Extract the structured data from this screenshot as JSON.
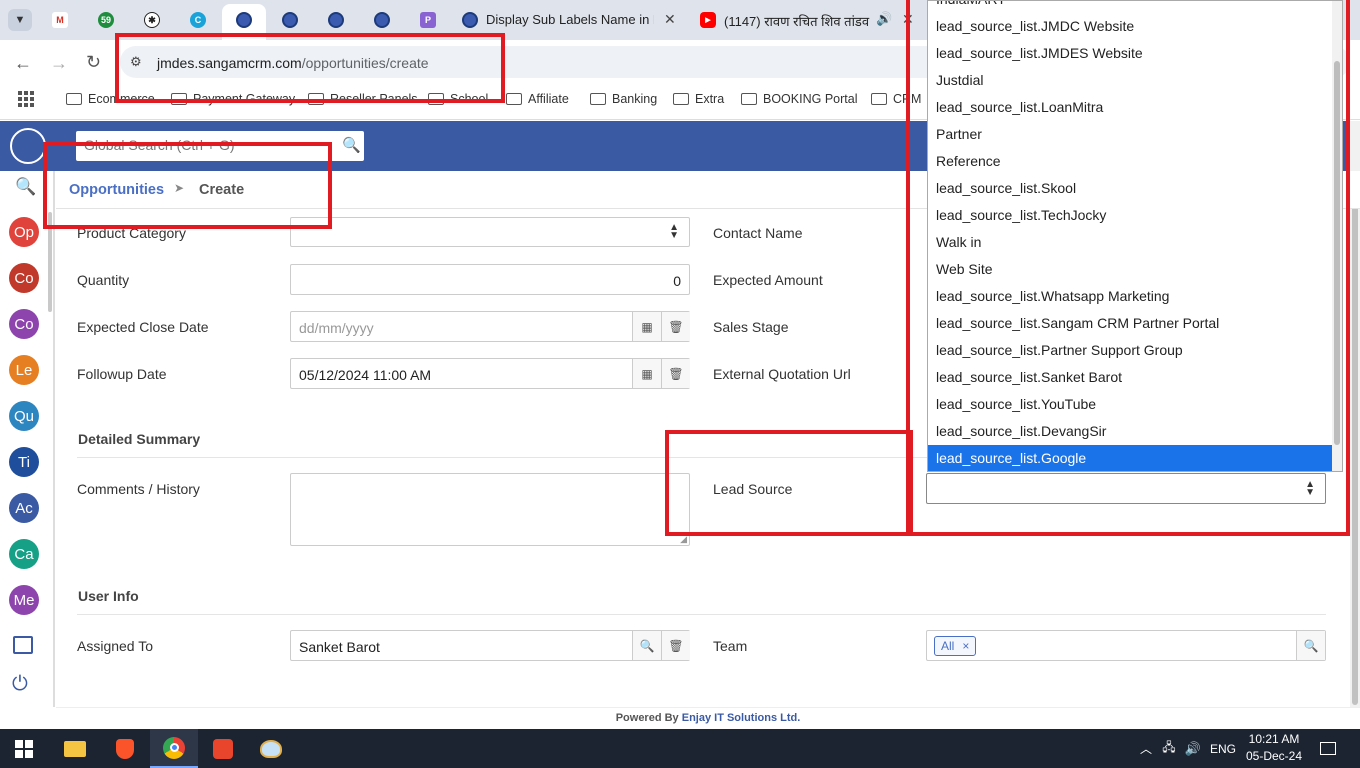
{
  "browser": {
    "tabs": [
      {
        "title": "Display Sub Labels Name in Dro"
      },
      {
        "title": "(1147) रावण रचित शिव तांडव"
      }
    ],
    "gmail_badge": "59",
    "url_host": "jmdes.sangamcrm.com",
    "url_path": "/opportunities/create",
    "bookmarks": [
      "Ecommerce",
      "Payment Gateway",
      "Reseller Panels",
      "School",
      "Affiliate",
      "Banking",
      "Extra",
      "BOOKING Portal",
      "CRM"
    ]
  },
  "app": {
    "search_placeholder": "Global Search (Ctrl + G)",
    "sidebar": [
      "Op",
      "Co",
      "Co",
      "Le",
      "Qu",
      "Ti",
      "Ac",
      "Ca",
      "Me"
    ],
    "sidebar_colors": [
      "#e0433b",
      "#c0392b",
      "#8e44ad",
      "#e67e22",
      "#2e86c1",
      "#1f4e9c",
      "#3b5aa4",
      "#16a085",
      "#8e44ad"
    ],
    "breadcrumb": {
      "module": "Opportunities",
      "action": "Create"
    },
    "form": {
      "product_category_label": "Product Category",
      "quantity_label": "Quantity",
      "quantity_value": "0",
      "expected_close_label": "Expected Close Date",
      "expected_close_placeholder": "dd/mm/yyyy",
      "followup_label": "Followup Date",
      "followup_value": "05/12/2024 11:00 AM",
      "contact_label": "Contact Name",
      "expected_amount_label": "Expected Amount",
      "sales_stage_label": "Sales Stage",
      "ext_quote_label": "External Quotation Url",
      "detailed_summary": "Detailed Summary",
      "comments_label": "Comments / History",
      "lead_source_label": "Lead Source",
      "user_info": "User Info",
      "assigned_label": "Assigned To",
      "assigned_value": "Sanket Barot",
      "team_label": "Team",
      "team_tag": "All",
      "team_tag_remove": "×"
    },
    "lead_source_options": [
      "IndiaMART",
      "lead_source_list.JMDC Website",
      "lead_source_list.JMDES Website",
      "Justdial",
      "lead_source_list.LoanMitra",
      "Partner",
      "Reference",
      "lead_source_list.Skool",
      "lead_source_list.TechJocky",
      "Walk in",
      "Web Site",
      "lead_source_list.Whatsapp Marketing",
      "lead_source_list.Sangam CRM Partner Portal",
      "lead_source_list.Partner Support Group",
      "lead_source_list.Sanket Barot",
      "lead_source_list.YouTube",
      "lead_source_list.DevangSir",
      "lead_source_list.Google"
    ],
    "selected_option_index": 17,
    "footer_prefix": "Powered By",
    "footer_company": "Enjay IT Solutions Ltd."
  },
  "taskbar": {
    "lang": "ENG",
    "time": "10:21 AM",
    "date": "05-Dec-24"
  }
}
